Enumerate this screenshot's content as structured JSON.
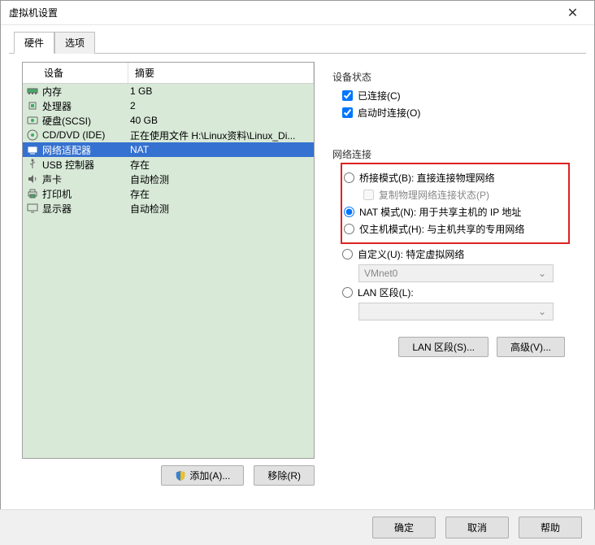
{
  "window": {
    "title": "虚拟机设置"
  },
  "tabs": {
    "hardware": "硬件",
    "options": "选项",
    "active": "hardware"
  },
  "list": {
    "header_device": "设备",
    "header_summary": "摘要",
    "rows": [
      {
        "icon": "memory",
        "name": "内存",
        "summary": "1 GB"
      },
      {
        "icon": "cpu",
        "name": "处理器",
        "summary": "2"
      },
      {
        "icon": "disk",
        "name": "硬盘(SCSI)",
        "summary": "40 GB"
      },
      {
        "icon": "cd",
        "name": "CD/DVD (IDE)",
        "summary": "正在使用文件 H:\\Linux资料\\Linux_Di..."
      },
      {
        "icon": "net",
        "name": "网络适配器",
        "summary": "NAT",
        "selected": true
      },
      {
        "icon": "usb",
        "name": "USB 控制器",
        "summary": "存在"
      },
      {
        "icon": "sound",
        "name": "声卡",
        "summary": "自动检测"
      },
      {
        "icon": "printer",
        "name": "打印机",
        "summary": "存在"
      },
      {
        "icon": "display",
        "name": "显示器",
        "summary": "自动检测"
      }
    ]
  },
  "left_buttons": {
    "add": "添加(A)...",
    "remove": "移除(R)"
  },
  "device_status": {
    "legend": "设备状态",
    "connected": "已连接(C)",
    "connect_at_power": "启动时连接(O)"
  },
  "network": {
    "legend": "网络连接",
    "bridged": "桥接模式(B): 直接连接物理网络",
    "replicate": "复制物理网络连接状态(P)",
    "nat": "NAT 模式(N): 用于共享主机的 IP 地址",
    "hostonly": "仅主机模式(H): 与主机共享的专用网络",
    "custom": "自定义(U): 特定虚拟网络",
    "custom_value": "VMnet0",
    "lan_segment": "LAN 区段(L):",
    "lan_value": ""
  },
  "right_buttons": {
    "lan": "LAN 区段(S)...",
    "advanced": "高级(V)..."
  },
  "footer": {
    "ok": "确定",
    "cancel": "取消",
    "help": "帮助"
  }
}
